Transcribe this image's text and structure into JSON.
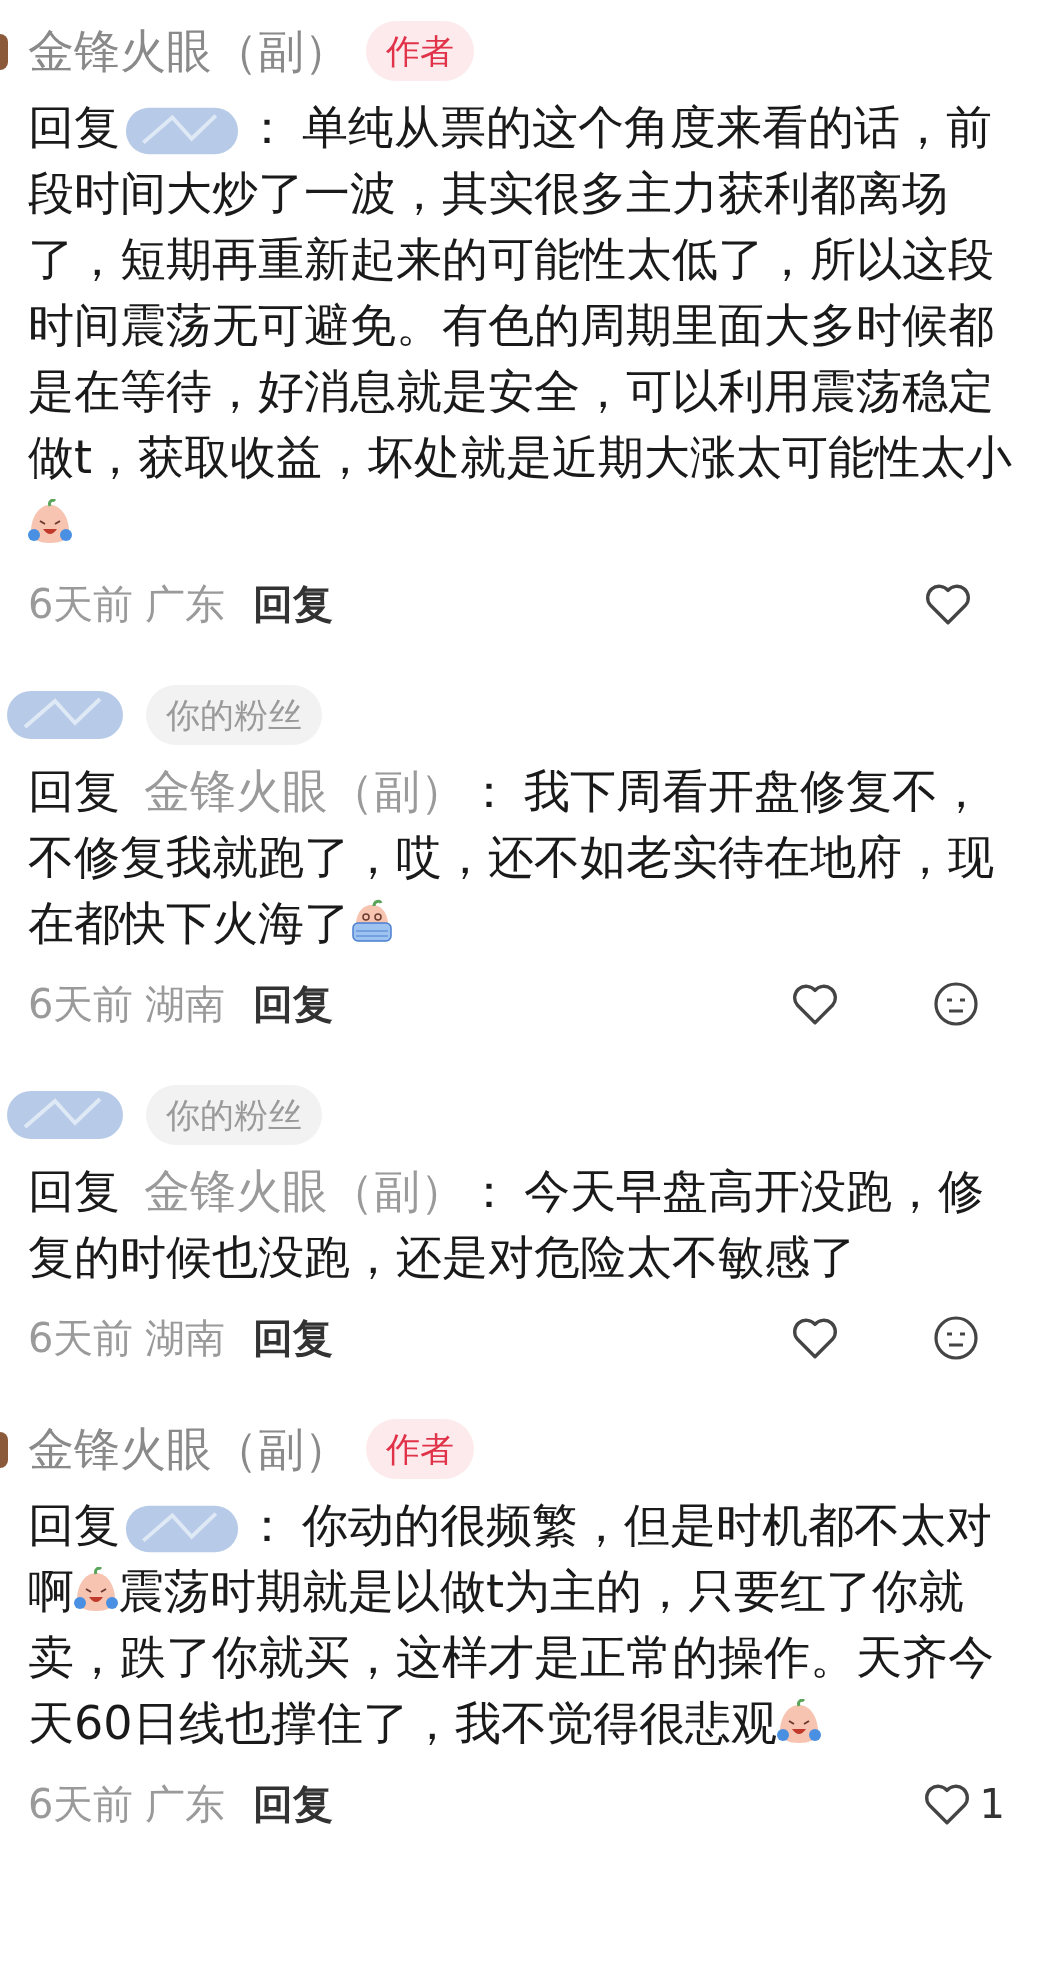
{
  "comments": [
    {
      "author": {
        "kind": "name",
        "text": "金锋火眼（副）"
      },
      "badge": {
        "kind": "author",
        "text": "作者"
      },
      "reply_label": "回复",
      "reply_to": {
        "kind": "hidden"
      },
      "colon": "：",
      "body": [
        {
          "kind": "text",
          "text": "单纯从票的这个角度来看的话，前段时间大炒了一波，其实很多主力获利都离场了，短期再重新起来的可能性太低了，所以这段时间震荡无可避免。有色的周期里面大多时候都是在等待，好消息就是安全，可以利用震荡稳定做t，获取收益，坏处就是近期大涨太可能性太小"
        },
        {
          "kind": "laugh_emoji"
        }
      ],
      "time": "6天前",
      "location": "广东",
      "reply_button": "回复",
      "show_dislike": false
    },
    {
      "author": {
        "kind": "hidden"
      },
      "badge": {
        "kind": "fan",
        "text": "你的粉丝"
      },
      "reply_label": "回复",
      "reply_to": {
        "kind": "name",
        "text": "金锋火眼（副）"
      },
      "colon": "：",
      "body": [
        {
          "kind": "text",
          "text": "我下周看开盘修复不，不修复我就跑了，哎，还不如老实待在地府，现在都快下火海了"
        },
        {
          "kind": "sob_emoji"
        }
      ],
      "time": "6天前",
      "location": "湖南",
      "reply_button": "回复",
      "show_dislike": true
    },
    {
      "author": {
        "kind": "hidden"
      },
      "badge": {
        "kind": "fan",
        "text": "你的粉丝"
      },
      "reply_label": "回复",
      "reply_to": {
        "kind": "name",
        "text": "金锋火眼（副）"
      },
      "colon": "：",
      "body": [
        {
          "kind": "text",
          "text": "今天早盘高开没跑，修复的时候也没跑，还是对危险太不敏感了"
        }
      ],
      "time": "6天前",
      "location": "湖南",
      "reply_button": "回复",
      "show_dislike": true
    },
    {
      "author": {
        "kind": "name",
        "text": "金锋火眼（副）"
      },
      "badge": {
        "kind": "author",
        "text": "作者"
      },
      "reply_label": "回复",
      "reply_to": {
        "kind": "hidden"
      },
      "colon": "：",
      "body": [
        {
          "kind": "text",
          "text": "你动的很频繁，但是时机都不太对啊"
        },
        {
          "kind": "laugh_emoji"
        },
        {
          "kind": "text",
          "text": "震荡时期就是以做t为主的，只要红了你就卖，跌了你就买，这样才是正常的操作。天齐今天60日线也撑住了，我不觉得很悲观"
        },
        {
          "kind": "laugh_emoji"
        }
      ],
      "time": "6天前",
      "location": "广东",
      "reply_button": "回复",
      "like_count": "1",
      "show_dislike": false
    }
  ]
}
